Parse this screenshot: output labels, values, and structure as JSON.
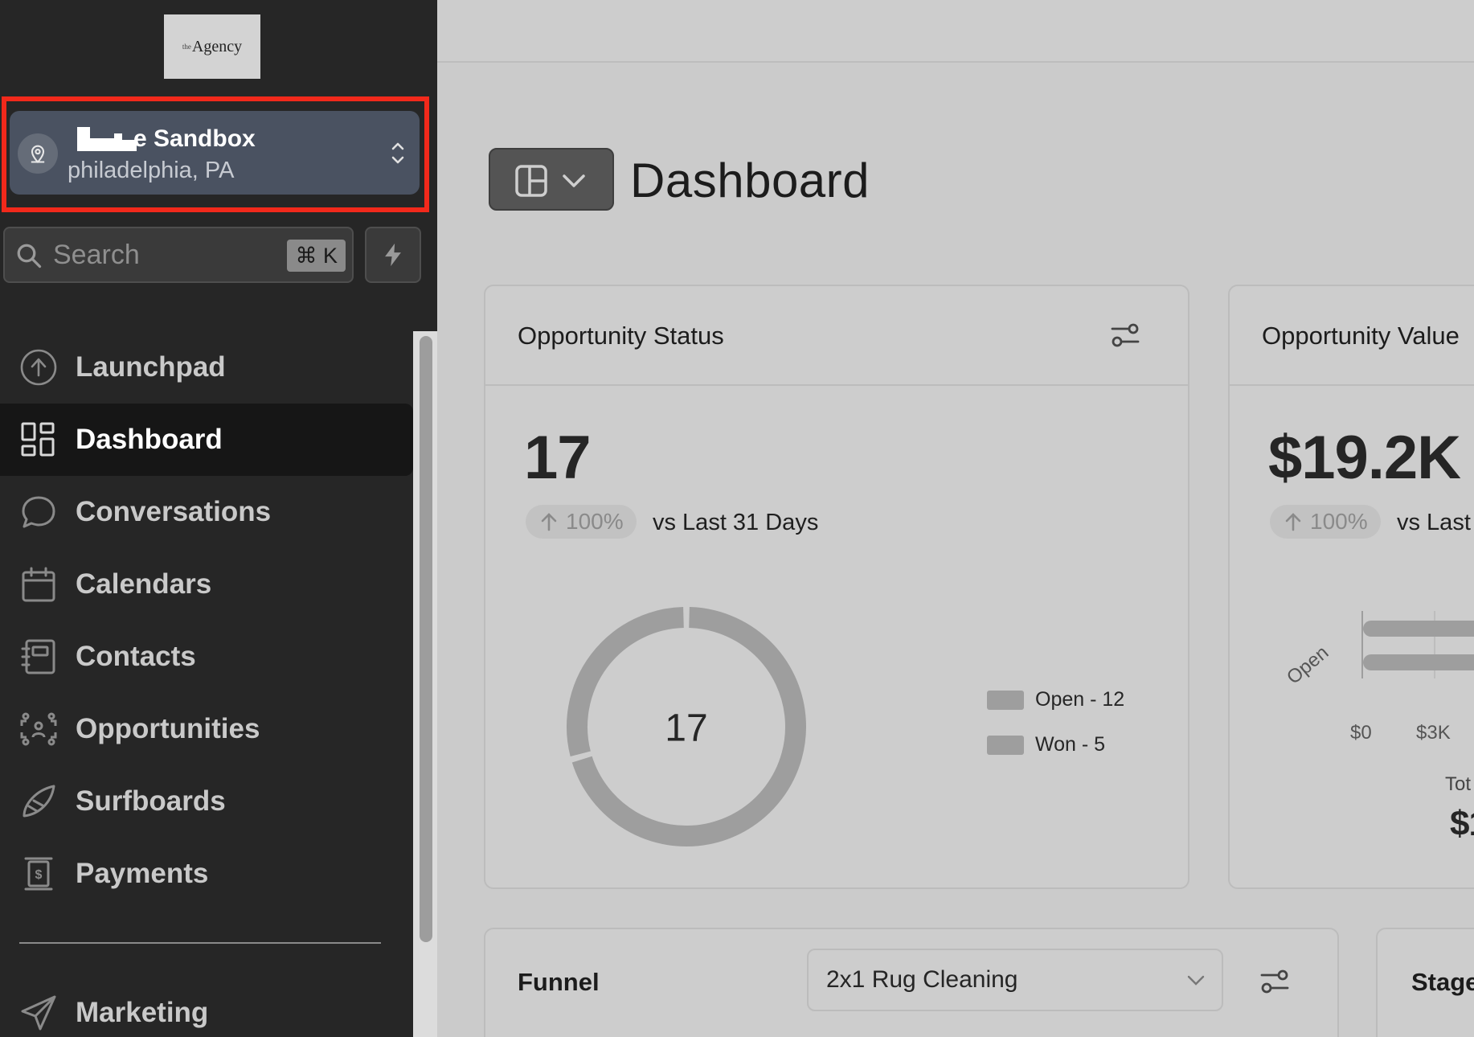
{
  "sidebar": {
    "logo": {
      "prefix": "the",
      "name": "Agency"
    },
    "location": {
      "name": "e Sandbox",
      "address": "philadelphia, PA"
    },
    "search": {
      "placeholder": "Search",
      "shortcut": "⌘ K"
    },
    "nav": [
      {
        "label": "Launchpad",
        "icon": "rocket-upload-icon"
      },
      {
        "label": "Dashboard",
        "icon": "dashboard-grid-icon",
        "active": true
      },
      {
        "label": "Conversations",
        "icon": "chat-bubble-icon"
      },
      {
        "label": "Calendars",
        "icon": "calendar-icon"
      },
      {
        "label": "Contacts",
        "icon": "contacts-book-icon"
      },
      {
        "label": "Opportunities",
        "icon": "opportunities-icon"
      },
      {
        "label": "Surfboards",
        "icon": "surfboard-icon"
      },
      {
        "label": "Payments",
        "icon": "payments-icon"
      },
      {
        "label": "Marketing",
        "icon": "send-icon"
      }
    ]
  },
  "main": {
    "title": "Dashboard",
    "cards": {
      "status": {
        "title": "Opportunity Status",
        "value": "17",
        "change": "100%",
        "compare": "vs Last 31 Days",
        "donut_center": "17"
      },
      "value": {
        "title": "Opportunity Value",
        "value": "$19.2K",
        "change": "100%",
        "compare": "vs Last",
        "bar_category": "Open",
        "total_label": "Tot",
        "total_value": "$1"
      },
      "funnel": {
        "title": "Funnel",
        "selected": "2x1 Rug Cleaning"
      },
      "stage": {
        "title": "Stage"
      }
    }
  },
  "chart_data": [
    {
      "type": "pie",
      "title": "",
      "center_label": "17",
      "categories": [
        "Open",
        "Won"
      ],
      "values": [
        12,
        5
      ],
      "legend": [
        "Open - 12",
        "Won - 5"
      ],
      "legend_placement": "right",
      "colors": [
        "#9e9e9e",
        "#9e9e9e"
      ]
    },
    {
      "type": "bar",
      "orientation": "horizontal",
      "categories": [
        "Open"
      ],
      "x_ticks": [
        "$0",
        "$3K"
      ],
      "grid": true
    }
  ],
  "colors": {
    "sidebar_bg": "#262626",
    "active_item_bg": "#161616",
    "location_card_bg": "#4a5261",
    "highlight_border": "#f2291b",
    "main_bg": "#cbcbcb",
    "chart_gray": "#9e9e9e"
  }
}
